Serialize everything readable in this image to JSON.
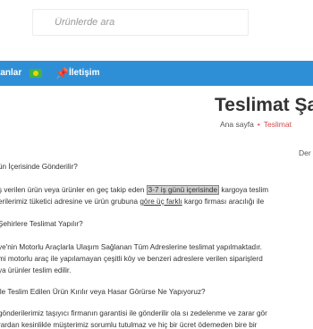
{
  "search": {
    "placeholder": "Ürünlerde ara"
  },
  "nav": {
    "left_label": "tanlar",
    "contact_label": "İletişim"
  },
  "page": {
    "title": "Teslimat Şar",
    "breadcrumb_home": "Ana sayfa",
    "breadcrumb_bullet": "•",
    "breadcrumb_current": "Teslimat",
    "right_label": "Der"
  },
  "content": {
    "q1": "ün İçerisinde Gönderilir?",
    "p1_a": "ş verilen ürün veya ürünler en geç takip eden ",
    "p1_highlight": "3-7 iş günü içerisinde",
    "p1_b": " kargoya teslim",
    "p1_c": "erilerimiz tüketici adresine ve ürün grubuna ",
    "p1_underline": "göre üç farklı",
    "p1_d": " kargo firması aracılığı ile",
    "q2": "Şehirlere Teslimat Yapılır?",
    "p2_a": "ye'nin Motorlu Araçlarla Ulaşım Sağlanan Tüm Adreslerine teslimat yapılmaktadır.",
    "p2_b": "mi motorlu araç ile yapılamayan çeşitli köy ve benzeri adreslere verilen siparişlerd",
    "p2_c": "ya ürünler teslim edilir.",
    "q3": "ile Teslim Edilen Ürün Kırılır veya Hasar Görürse Ne Yapıyoruz?",
    "p3_a": "gönderilerimiz taşıyıcı firmanın garantisi ile gönderilir ola sı zedelenme ve zarar gör",
    "p3_b": "rardan kesinlikle müşterimiz sorumlu tutulmaz ve hiç bir ücret ödemeden bire bir"
  }
}
